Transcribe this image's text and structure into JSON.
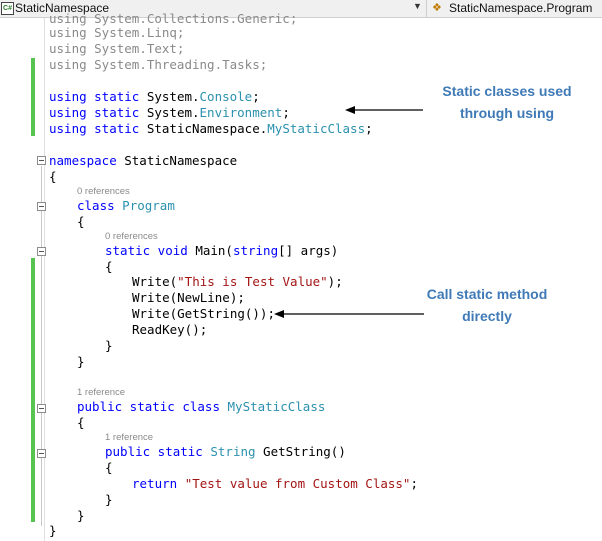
{
  "navbar": {
    "project_icon": "csharp-project-icon",
    "project_label": "StaticNamespace",
    "dropdown_icon": "chevron-down-icon",
    "class_icon": "class-icon",
    "class_label": "StaticNamespace.Program"
  },
  "code": {
    "l0": "using System.Collections.Generic;",
    "l1": "using System.Linq;",
    "l2": "using System.Text;",
    "l3": "using System.Threading.Tasks;",
    "l5_kw": "using static ",
    "l5_a": "System.",
    "l5_b": "Console",
    "l5_c": ";",
    "l6_kw": "using static ",
    "l6_a": "System.",
    "l6_b": "Environment",
    "l6_c": ";",
    "l7_kw": "using static ",
    "l7_a": "StaticNamespace.",
    "l7_b": "MyStaticClass",
    "l7_c": ";",
    "l9_kw": "namespace",
    "l9_a": " StaticNamespace",
    "l10": "{",
    "ref1": "0 references",
    "l12_kw": "class",
    "l12_a": " ",
    "l12_b": "Program",
    "l13": "{",
    "ref2": "0 references",
    "l15_kw": "static void",
    "l15_a": " Main(",
    "l15_b": "string",
    "l15_c": "[] args)",
    "l16": "{",
    "l17_a": "Write(",
    "l17_b": "\"This is Test Value\"",
    "l17_c": ");",
    "l18": "Write(NewLine);",
    "l19": "Write(GetString());",
    "l20": "ReadKey();",
    "l21": "}",
    "l22": "}",
    "ref3": "1 reference",
    "l25_kw": "public static class",
    "l25_a": " ",
    "l25_b": "MyStaticClass",
    "l26": "{",
    "ref4": "1 reference",
    "l28_kw": "public static",
    "l28_a": " ",
    "l28_b": "String",
    "l28_c": " GetString()",
    "l29": "{",
    "l30_kw": "return",
    "l30_a": " ",
    "l30_b": "\"Test value from Custom Class\"",
    "l30_c": ";",
    "l31": "}",
    "l32": "}",
    "l33": "}"
  },
  "annotations": {
    "static_classes_line1": "Static classes used",
    "static_classes_line2": "through using",
    "call_static_line1": "Call static method",
    "call_static_line2": "directly"
  },
  "colors": {
    "keyword": "#0000ff",
    "type": "#2b91af",
    "string": "#a31515",
    "annotation": "#3f7ab6",
    "change_bar": "#57c452"
  }
}
